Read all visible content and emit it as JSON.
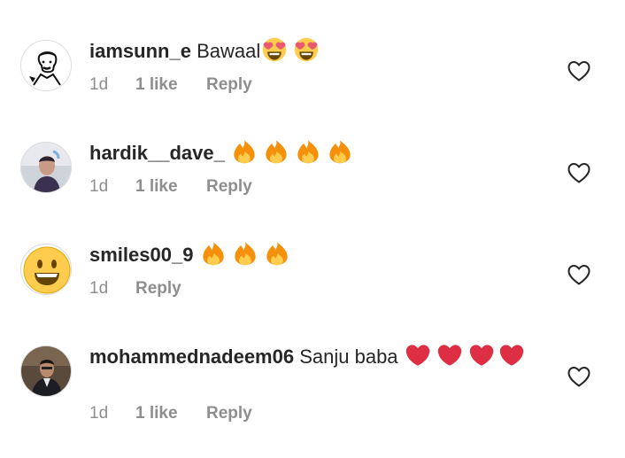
{
  "comments": [
    {
      "username": "iamsunn_e",
      "text": "Bawaal",
      "emojis": [
        "heart-eyes-emoji",
        "heart-eyes-emoji"
      ],
      "time": "1d",
      "likes": "1 like",
      "reply": "Reply"
    },
    {
      "username": "hardik__dave_",
      "text": "",
      "emojis": [
        "fire-emoji",
        "fire-emoji",
        "fire-emoji",
        "fire-emoji"
      ],
      "time": "1d",
      "likes": "1 like",
      "reply": "Reply"
    },
    {
      "username": "smiles00_9",
      "text": "",
      "emojis": [
        "fire-emoji",
        "fire-emoji",
        "fire-emoji"
      ],
      "time": "1d",
      "likes": "",
      "reply": "Reply"
    },
    {
      "username": "mohammednadeem06",
      "text": "Sanju baba",
      "emojis": [
        "red-heart-emoji",
        "red-heart-emoji",
        "red-heart-emoji",
        "red-heart-emoji"
      ],
      "time": "1d",
      "likes": "1 like",
      "reply": "Reply"
    }
  ],
  "colors": {
    "text": "#262626",
    "secondary": "#8e8e8e",
    "fire": "#f4900c",
    "heart": "#dd2e44",
    "emoji_face": "#ffcc4d"
  },
  "icons": {
    "like": "heart-outline-icon"
  }
}
